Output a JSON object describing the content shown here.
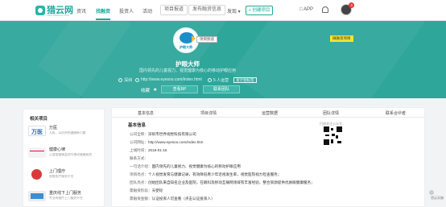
{
  "brand": {
    "name": "猎云网",
    "tagline": "LIEYUNWANG.COM"
  },
  "nav": {
    "items": [
      "资讯",
      "找融资",
      "投资人",
      "活动"
    ],
    "active_index": 1,
    "boxed": [
      "项目报道",
      "发布融资信息"
    ],
    "more": "发现 ▾",
    "create": "+ 创建项目",
    "app": "□ APP",
    "notif_count": "3"
  },
  "hero": {
    "logo_text": "护眼大师",
    "label_tag": "项目频道",
    "fin_tag": "微融资项目",
    "title": "护眼大师",
    "desc": "国内领先的儿童视力、视觉健康为核心的移动护眼应用",
    "location": "深圳",
    "website": "http://www.eyesoo.com/index.html",
    "members": "5 人运营",
    "btn_tag": "发计划标签",
    "collect": "收藏",
    "btn1": "查看BP",
    "btn2": "联系团队",
    "accent": "#2ea69a"
  },
  "side": {
    "title": "相关项目",
    "items": [
      {
        "name": "万医",
        "sub": "万医，以药师的健康新引路"
      },
      {
        "name": "健康心律",
        "sub": "心血管健康监测与移动健康服务"
      },
      {
        "name": "上门理疗",
        "sub": "智能医疗服务平台"
      },
      {
        "name": "重庆线下上门服务",
        "sub": "专业的理疗上门服务平台"
      }
    ]
  },
  "main": {
    "tabs": [
      "基本信息",
      "项目详情",
      "运营数据",
      "团队详情",
      "联系合伙者"
    ],
    "section": "基本信息",
    "qr_caption": "扫描关注公众号",
    "rows": [
      {
        "k": "公司全称：",
        "v": "深圳市世界视觉科技有限公司"
      },
      {
        "k": "公司网址：",
        "v": "http://www.eyesoo.com/index.htm"
      },
      {
        "k": "上线时间：",
        "v": "2015-01-15"
      },
      {
        "k": "联系方式：",
        "v": ""
      },
      {
        "k": "一句话介绍：",
        "v": "国内领先的儿童视力、视觉健康为核心的移动护眼应用"
      },
      {
        "k": "项目亮点：",
        "v": "个人视觉发育与健康记录，有效降低青少年近视发生率，视觉医院视力检查服务；"
      },
      {
        "k": "团队亮点：",
        "v": "创始团队来自知名企业及医院，在眼科及移动互联网领域有丰富经验，整合资源提供优质眼健康服务；"
      },
      {
        "k": "需融资阶段：",
        "v": "天使轮"
      },
      {
        "k": "需融资金额：",
        "v": "认证投资人可查看（点击认证投资人）"
      }
    ]
  },
  "float": {
    "label": "猎云采编"
  }
}
